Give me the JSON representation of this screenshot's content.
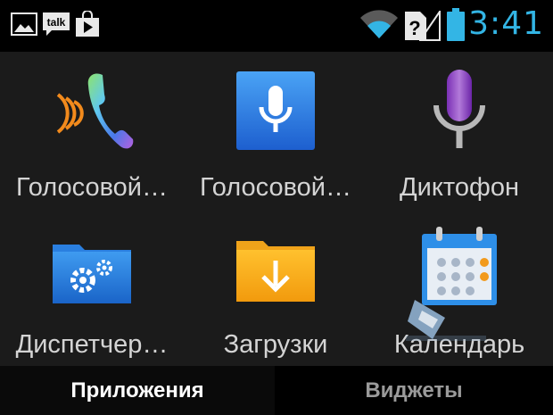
{
  "status_bar": {
    "clock": "3:41",
    "notification_icons": [
      "gallery-icon",
      "talk-icon",
      "play-store-icon"
    ],
    "talk_text": "talk",
    "system_icons": [
      "wifi-icon",
      "no-sim-icon",
      "signal-icon",
      "battery-icon"
    ],
    "accent_color": "#33b5e5"
  },
  "apps": [
    {
      "label": "Голосовой…",
      "icon": "phone-voice-icon"
    },
    {
      "label": "Голосовой…",
      "icon": "voice-search-icon"
    },
    {
      "label": "Диктофон",
      "icon": "dictaphone-icon"
    },
    {
      "label": "Диспетчер…",
      "icon": "file-manager-icon"
    },
    {
      "label": "Загрузки",
      "icon": "downloads-icon"
    },
    {
      "label": "Календарь",
      "icon": "calendar-icon"
    }
  ],
  "tabs": {
    "apps": "Приложения",
    "widgets": "Виджеты"
  }
}
